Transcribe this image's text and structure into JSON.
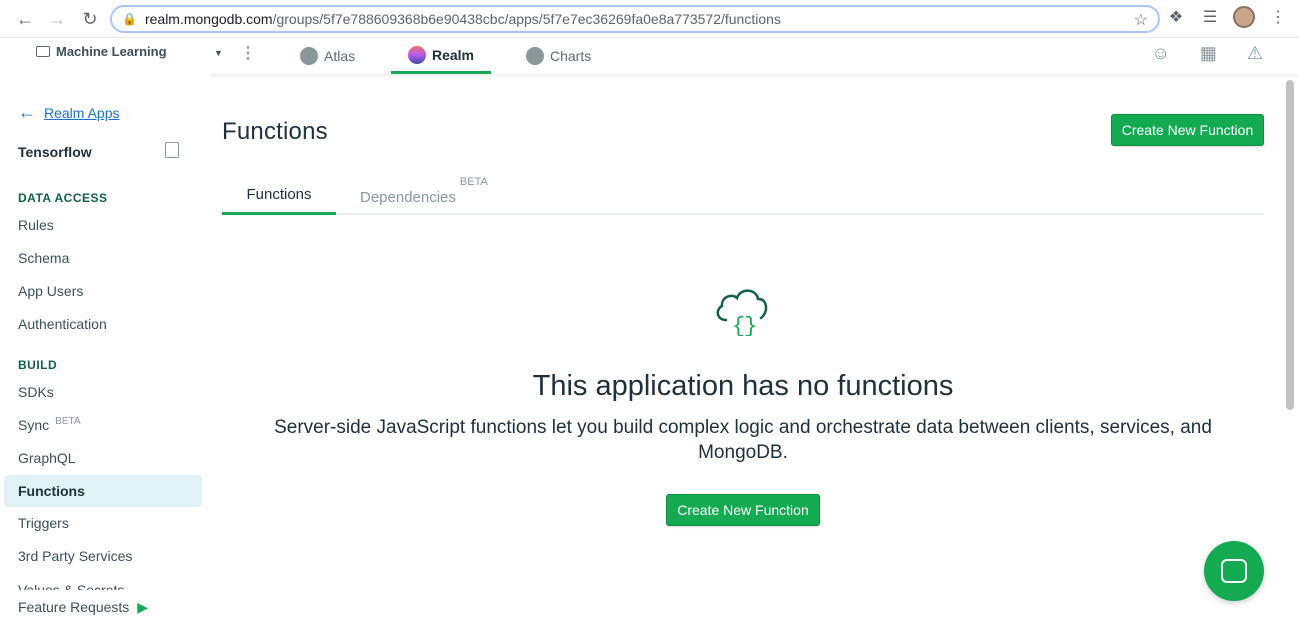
{
  "browser": {
    "url_host": "realm.mongodb.com",
    "url_path": "/groups/5f7e788609368b6e90438cbc/apps/5f7e7ec36269fa0e8a773572/functions"
  },
  "topnav": {
    "project_name": "Machine Learning",
    "tabs": [
      {
        "label": "Atlas",
        "active": false
      },
      {
        "label": "Realm",
        "active": true
      },
      {
        "label": "Charts",
        "active": false
      }
    ]
  },
  "sidebar": {
    "back_label": "Realm Apps",
    "app_name": "Tensorflow",
    "sections": [
      {
        "title": "DATA ACCESS",
        "items": [
          {
            "label": "Rules"
          },
          {
            "label": "Schema"
          },
          {
            "label": "App Users"
          },
          {
            "label": "Authentication"
          }
        ]
      },
      {
        "title": "BUILD",
        "items": [
          {
            "label": "SDKs"
          },
          {
            "label": "Sync",
            "badge": "BETA"
          },
          {
            "label": "GraphQL"
          },
          {
            "label": "Functions",
            "active": true
          },
          {
            "label": "Triggers"
          },
          {
            "label": "3rd Party Services"
          }
        ]
      }
    ],
    "cut_item": "Values & Secrets",
    "feature_requests": "Feature Requests"
  },
  "main": {
    "title": "Functions",
    "create_button": "Create New Function",
    "tabs": [
      {
        "label": "Functions",
        "active": true
      },
      {
        "label": "Dependencies",
        "badge": "BETA",
        "active": false
      }
    ],
    "empty_state": {
      "title": "This application has no functions",
      "description": "Server-side JavaScript functions let you build complex logic and orchestrate data between clients, services, and MongoDB.",
      "button": "Create New Function"
    }
  },
  "colors": {
    "accent_green": "#13aa52",
    "active_bg": "#e1f2f6",
    "link_blue": "#1a73c8"
  }
}
